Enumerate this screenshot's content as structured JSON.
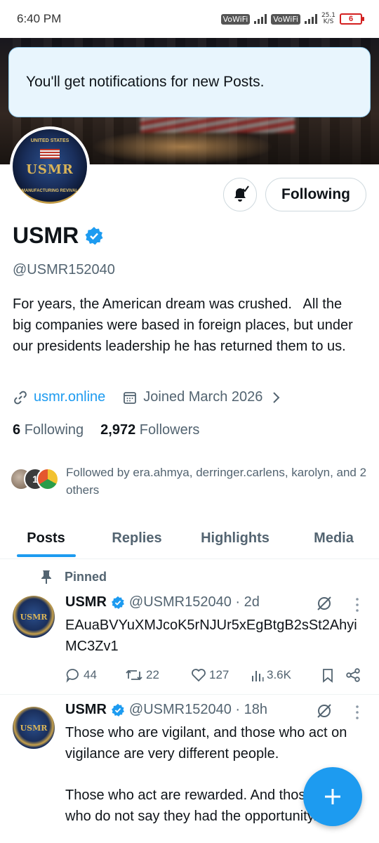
{
  "status_bar": {
    "time": "6:40 PM",
    "wifi_label_1": "VoWiFi",
    "wifi_label_2": "VoWiFi",
    "net_speed_value": "25.1",
    "net_speed_unit": "K/S",
    "battery": "6"
  },
  "toast": {
    "message": "You'll get notifications for new Posts."
  },
  "avatar": {
    "top_text": "UNITED STATES",
    "main_text": "USMR",
    "bottom_text": "MANUFACTURING REVIVAL"
  },
  "actions": {
    "following_label": "Following"
  },
  "profile": {
    "name": "USMR",
    "handle": "@USMR152040",
    "bio": "For years, the American dream was crushed.   All the big companies were based in foreign places, but under our presidents leadership he has returned them to us.",
    "website": "usmr.online",
    "joined": "Joined March 2026",
    "following_count": "6",
    "following_label": "Following",
    "followers_count": "2,972",
    "followers_label": "Followers",
    "followed_by": "Followed by era.ahmya, derringer.carlens, karolyn, and 2 others",
    "followed_badge": "1"
  },
  "tabs": [
    "Posts",
    "Replies",
    "Highlights",
    "Media"
  ],
  "posts": [
    {
      "pinned_label": "Pinned",
      "name": "USMR",
      "handle_time": "@USMR152040 · 2d",
      "body": "EAuaBVYuXMJcoK5rNJUr5xEgBtgB2sSt2AhyiMC3Zv1",
      "replies": "44",
      "reposts": "22",
      "likes": "127",
      "views": "3.6K"
    },
    {
      "name": "USMR",
      "handle_time": "@USMR152040 · 18h",
      "body_line1": "Those who are vigilant, and those who act on vigilance are very different people.",
      "body_line2": "Those who act are rewarded. And those",
      "body_line3": "who do not say they had the opportunity."
    }
  ],
  "colors": {
    "accent": "#1d9bf0",
    "text": "#0f1419",
    "secondary": "#536471",
    "toast_bg": "#e8f5fd",
    "toast_border": "#8fcbee"
  }
}
